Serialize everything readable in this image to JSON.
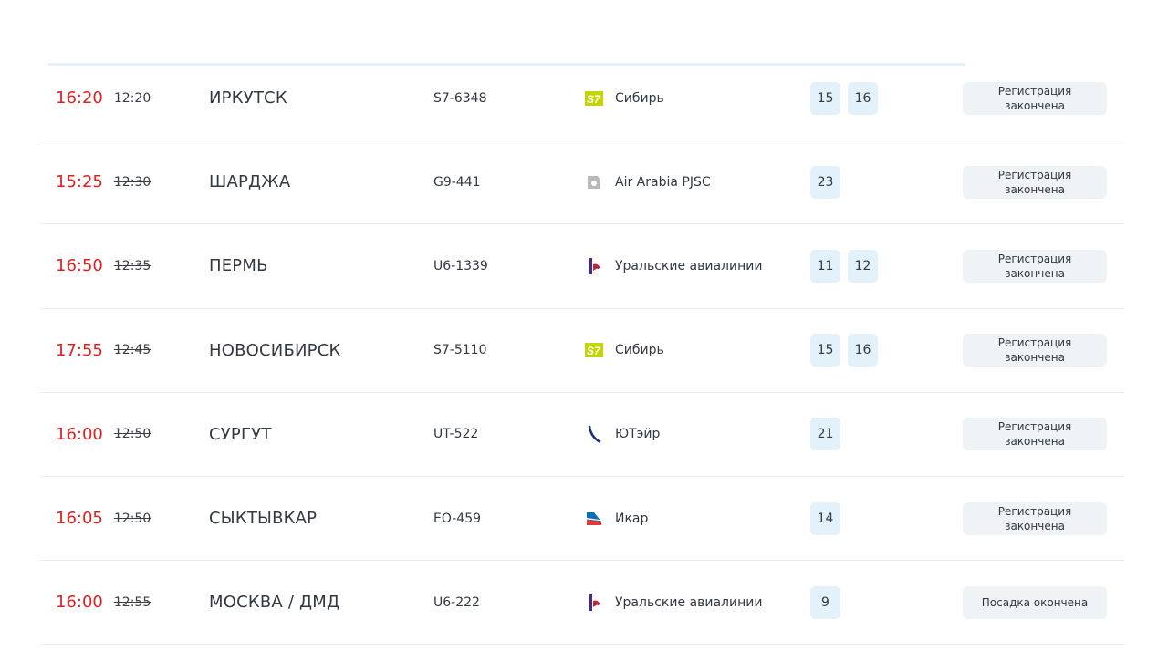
{
  "flights": [
    {
      "time_actual": "16:20",
      "time_scheduled": "12:20",
      "destination": "ИРКУТСК",
      "flight": "S7-6348",
      "airline": "Сибирь",
      "airline_icon": "s7-logo-icon",
      "gates": [
        "15",
        "16"
      ],
      "status": "Регистрация закончена"
    },
    {
      "time_actual": "15:25",
      "time_scheduled": "12:30",
      "destination": "ШАРДЖА",
      "flight": "G9-441",
      "airline": "Air Arabia PJSC",
      "airline_icon": "air-arabia-logo-icon",
      "gates": [
        "23"
      ],
      "status": "Регистрация закончена"
    },
    {
      "time_actual": "16:50",
      "time_scheduled": "12:35",
      "destination": "ПЕРМЬ",
      "flight": "U6-1339",
      "airline": "Уральские авиалинии",
      "airline_icon": "ural-airlines-logo-icon",
      "gates": [
        "11",
        "12"
      ],
      "status": "Регистрация закончена"
    },
    {
      "time_actual": "17:55",
      "time_scheduled": "12:45",
      "destination": "НОВОСИБИРСК",
      "flight": "S7-5110",
      "airline": "Сибирь",
      "airline_icon": "s7-logo-icon",
      "gates": [
        "15",
        "16"
      ],
      "status": "Регистрация закончена"
    },
    {
      "time_actual": "16:00",
      "time_scheduled": "12:50",
      "destination": "СУРГУТ",
      "flight": "UT-522",
      "airline": "ЮТэйр",
      "airline_icon": "utair-logo-icon",
      "gates": [
        "21"
      ],
      "status": "Регистрация закончена"
    },
    {
      "time_actual": "16:05",
      "time_scheduled": "12:50",
      "destination": "СЫКТЫВКАР",
      "flight": "EO-459",
      "airline": "Икар",
      "airline_icon": "ikar-logo-icon",
      "gates": [
        "14"
      ],
      "status": "Регистрация закончена"
    },
    {
      "time_actual": "16:00",
      "time_scheduled": "12:55",
      "destination": "МОСКВА / ДМД",
      "flight": "U6-222",
      "airline": "Уральские авиалинии",
      "airline_icon": "ural-airlines-logo-icon",
      "gates": [
        "9"
      ],
      "status": "Посадка окончена"
    }
  ],
  "colors": {
    "time_actual": "#e02020",
    "gate_bg": "#e3f1fa",
    "status_bg": "#f0f3f5",
    "text": "#333940"
  }
}
